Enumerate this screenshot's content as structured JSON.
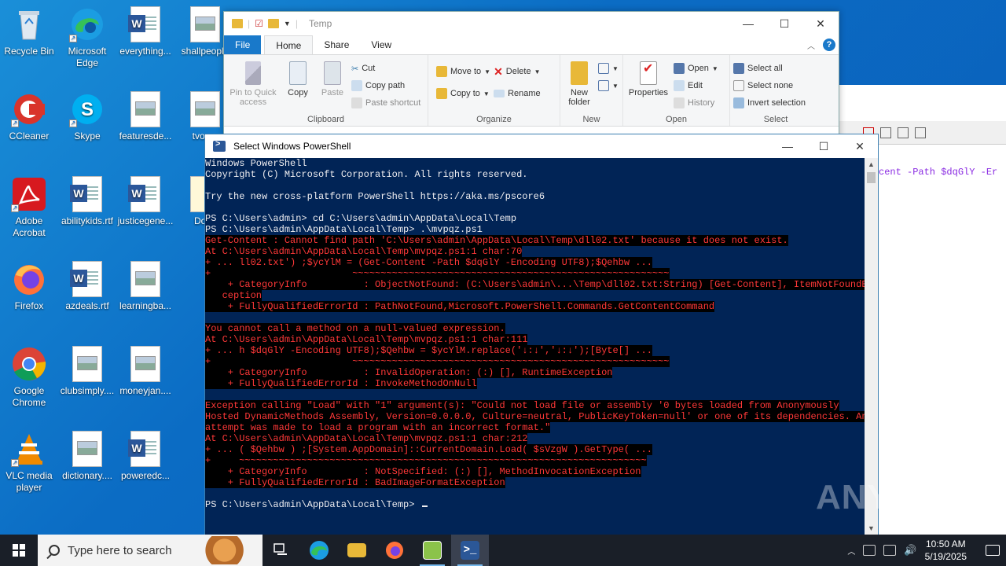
{
  "desktop": {
    "icons": [
      {
        "label": "Recycle Bin"
      },
      {
        "label": "Microsoft Edge"
      },
      {
        "label": "everything..."
      },
      {
        "label": "shallpeople"
      },
      {
        "label": "CCleaner"
      },
      {
        "label": "Skype"
      },
      {
        "label": "featuresde..."
      },
      {
        "label": "tvover"
      },
      {
        "label": "Adobe Acrobat"
      },
      {
        "label": "abilitykids.rtf"
      },
      {
        "label": "justicegene..."
      },
      {
        "label": "Docu"
      },
      {
        "label": "Firefox"
      },
      {
        "label": "azdeals.rtf"
      },
      {
        "label": "learningba..."
      },
      {
        "label": "Google Chrome"
      },
      {
        "label": "clubsimply...."
      },
      {
        "label": "moneyjan...."
      },
      {
        "label": "VLC media player"
      },
      {
        "label": "dictionary...."
      },
      {
        "label": "poweredc..."
      }
    ]
  },
  "explorer": {
    "title": "Temp",
    "tabs": {
      "file": "File",
      "home": "Home",
      "share": "Share",
      "view": "View"
    },
    "clipboard": {
      "pin": "Pin to Quick access",
      "copy": "Copy",
      "paste": "Paste",
      "cut": "Cut",
      "copy_path": "Copy path",
      "paste_shortcut": "Paste shortcut",
      "group": "Clipboard"
    },
    "organize": {
      "move_to": "Move to",
      "copy_to": "Copy to",
      "delete": "Delete",
      "rename": "Rename",
      "group": "Organize"
    },
    "new": {
      "new_folder": "New folder",
      "group": "New"
    },
    "open": {
      "properties": "Properties",
      "open": "Open",
      "edit": "Edit",
      "history": "History",
      "group": "Open"
    },
    "select": {
      "select_all": "Select all",
      "select_none": "Select none",
      "invert": "Invert selection",
      "group": "Select"
    }
  },
  "background_window": {
    "code": "cent -Path $dqGlY -Er"
  },
  "powershell": {
    "title": "Select Windows PowerShell",
    "lines": [
      {
        "t": "Windows PowerShell",
        "err": false
      },
      {
        "t": "Copyright (C) Microsoft Corporation. All rights reserved.",
        "err": false
      },
      {
        "t": "",
        "err": false
      },
      {
        "t": "Try the new cross-platform PowerShell https://aka.ms/pscore6",
        "err": false
      },
      {
        "t": "",
        "err": false
      },
      {
        "t": "PS C:\\Users\\admin> cd C:\\Users\\admin\\AppData\\Local\\Temp",
        "err": false
      },
      {
        "t": "PS C:\\Users\\admin\\AppData\\Local\\Temp> .\\mvpqz.ps1",
        "err": false
      },
      {
        "t": "Get-Content : Cannot find path 'C:\\Users\\admin\\AppData\\Local\\Temp\\dll02.txt' because it does not exist.",
        "err": true
      },
      {
        "t": "At C:\\Users\\admin\\AppData\\Local\\Temp\\mvpqz.ps1:1 char:70",
        "err": true
      },
      {
        "t": "+ ... ll02.txt') ;$ycYlM = (Get-Content -Path $dqGlY -Encoding UTF8);$Qehbw ...",
        "err": true
      },
      {
        "t": "+                         ~~~~~~~~~~~~~~~~~~~~~~~~~~~~~~~~~~~~~~~~~~~~~~~~~~~~~~~~",
        "err": true
      },
      {
        "t": "    + CategoryInfo          : ObjectNotFound: (C:\\Users\\admin\\...\\Temp\\dll02.txt:String) [Get-Content], ItemNotFoundEx",
        "err": true
      },
      {
        "t": "   ception",
        "err": true
      },
      {
        "t": "    + FullyQualifiedErrorId : PathNotFound,Microsoft.PowerShell.Commands.GetContentCommand",
        "err": true
      },
      {
        "t": "",
        "err": false
      },
      {
        "t": "You cannot call a method on a null-valued expression.",
        "err": true
      },
      {
        "t": "At C:\\Users\\admin\\AppData\\Local\\Temp\\mvpqz.ps1:1 char:111",
        "err": true
      },
      {
        "t": "+ ... h $dqGlY -Encoding UTF8);$Qehbw = $ycYlM.replace('↓:↓','↓:↓');[Byte[] ...",
        "err": true
      },
      {
        "t": "+                         ~~~~~~~~~~~~~~~~~~~~~~~~~~~~~~~~~~~~~~~~~~~~~~~~~~~~~~~~",
        "err": true
      },
      {
        "t": "    + CategoryInfo          : InvalidOperation: (:) [], RuntimeException",
        "err": true
      },
      {
        "t": "    + FullyQualifiedErrorId : InvokeMethodOnNull",
        "err": true
      },
      {
        "t": "",
        "err": false
      },
      {
        "t": "Exception calling \"Load\" with \"1\" argument(s): \"Could not load file or assembly '0 bytes loaded from Anonymously",
        "err": true
      },
      {
        "t": "Hosted DynamicMethods Assembly, Version=0.0.0.0, Culture=neutral, PublicKeyToken=null' or one of its dependencies. An",
        "err": true
      },
      {
        "t": "attempt was made to load a program with an incorrect format.\"",
        "err": true
      },
      {
        "t": "At C:\\Users\\admin\\AppData\\Local\\Temp\\mvpqz.ps1:1 char:212",
        "err": true
      },
      {
        "t": "+ ... ( $Qehbw ) ;[System.AppDomain]::CurrentDomain.Load( $sVzgW ).GetType( ...",
        "err": true
      },
      {
        "t": "+     ~~~~~~~~~~~~~~~~~~~~~~~~~~~~~~~~~~~~~~~~~~~~~~~~~~~~~~~~~~~~~~~~~~~~~~~~",
        "err": true
      },
      {
        "t": "    + CategoryInfo          : NotSpecified: (:) [], MethodInvocationException",
        "err": true
      },
      {
        "t": "    + FullyQualifiedErrorId : BadImageFormatException",
        "err": true
      },
      {
        "t": "",
        "err": false
      },
      {
        "t": "PS C:\\Users\\admin\\AppData\\Local\\Temp> ",
        "err": false
      }
    ]
  },
  "watermark": "ANY RUN",
  "taskbar": {
    "search_placeholder": "Type here to search",
    "time": "10:50 AM",
    "date": "5/19/2025"
  },
  "colors": {
    "console_bg": "#012456",
    "error_text": "#ff3838",
    "desktop_bg": "#0b6cc4"
  }
}
